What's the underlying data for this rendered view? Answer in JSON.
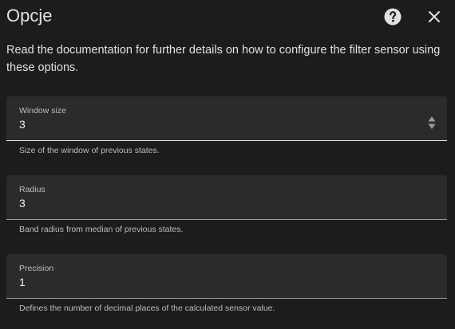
{
  "dialog": {
    "title": "Opcje",
    "description": "Read the documentation for further details on how to configure the filter sensor using these options."
  },
  "fields": [
    {
      "label": "Window size",
      "value": "3",
      "helper": "Size of the window of previous states."
    },
    {
      "label": "Radius",
      "value": "3",
      "helper": "Band radius from median of previous states."
    },
    {
      "label": "Precision",
      "value": "1",
      "helper": "Defines the number of decimal places of the calculated sensor value."
    }
  ],
  "icons": {
    "help": "help-circle-icon",
    "close": "close-icon",
    "stepper": "up-down-stepper-icon"
  },
  "colors": {
    "background": "#1c1c1c",
    "field_background": "#2b2b2b",
    "text": "#e1e1e1",
    "muted": "#bdbdbd"
  }
}
